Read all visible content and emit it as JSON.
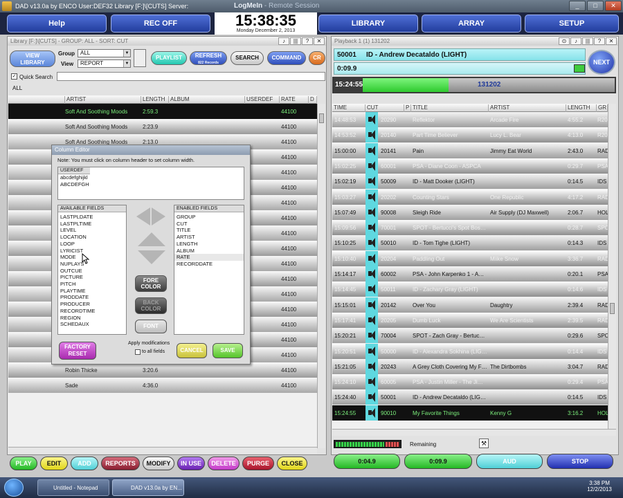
{
  "window": {
    "title": "DAD v13.0a by ENCO User:DEF32 Library [F:]\\[CUTS] Server:",
    "session_title": "LogMeIn",
    "session_sub": " - Remote Session"
  },
  "nav": {
    "help": "Help",
    "rec_off": "REC OFF",
    "library": "LIBRARY",
    "array": "ARRAY",
    "setup": "SETUP"
  },
  "clock": {
    "time": "15:38:35",
    "date": "Monday December 2, 2013"
  },
  "library": {
    "header": "Library [F:]\\[CUTS] - GROUP: ALL  - SORT: CUT",
    "view_library": "VIEW\nLIBRARY",
    "group_label": "Group",
    "group_value": "ALL",
    "view_label": "View",
    "view_value": "REPORT",
    "playlist": "PLAYLIST",
    "refresh": "REFRESH",
    "refresh_sub": "822 Records",
    "search": "SEARCH",
    "command": "COMMAND",
    "cr": "CR",
    "quick_search": "Quick Search",
    "filter_tab": "ALL",
    "columns": [
      "ARTIST",
      "LENGTH",
      "ALBUM",
      "USERDEF",
      "RATE",
      "D"
    ],
    "rows": [
      {
        "artist": "Soft And Soothing Moods",
        "length": "2:59.3",
        "rate": "44100"
      },
      {
        "artist": "Soft And Soothing Moods",
        "length": "2:23.9",
        "rate": "44100"
      },
      {
        "artist": "Soft And Soothing Moods",
        "length": "2:13.0",
        "rate": "44100"
      },
      {
        "artist": "",
        "length": "",
        "rate": "44100"
      },
      {
        "artist": "",
        "length": "",
        "rate": "44100"
      },
      {
        "artist": "",
        "length": "",
        "rate": "44100"
      },
      {
        "artist": "",
        "length": "",
        "rate": "44100"
      },
      {
        "artist": "",
        "length": "",
        "rate": "44100"
      },
      {
        "artist": "",
        "length": "",
        "rate": "44100"
      },
      {
        "artist": "",
        "length": "",
        "rate": "44100"
      },
      {
        "artist": "",
        "length": "",
        "rate": "44100"
      },
      {
        "artist": "",
        "length": "",
        "rate": "44100"
      },
      {
        "artist": "",
        "length": "",
        "rate": "44100"
      },
      {
        "artist": "",
        "length": "",
        "rate": "44100"
      },
      {
        "artist": "Sade",
        "length": "4:02.0",
        "rate": "44100"
      },
      {
        "artist": "Paul Taylor",
        "length": "3:50.8",
        "rate": "44100"
      },
      {
        "artist": "Harry Connick Jr.",
        "length": "3:37.7",
        "rate": "44100"
      },
      {
        "artist": "Robin Thicke",
        "length": "3:20.6",
        "rate": "44100"
      },
      {
        "artist": "Sade",
        "length": "4:36.0",
        "rate": "44100"
      }
    ]
  },
  "column_editor": {
    "title": "Column Editor",
    "note": "Note: You must click on column header to set column width.",
    "userdef_head": "USERDEF",
    "userdef_items": [
      "abcdefghijkl",
      "ABCDEFGH"
    ],
    "available_head": "AVAILABLE FIELDS",
    "available": [
      "LASTPLDATE",
      "LASTPLTIME",
      "LEVEL",
      "LOCATION",
      "LOOP",
      "LYRICIST",
      "MODE",
      "NUPLAYS",
      "OUTCUE",
      "PICTURE",
      "PITCH",
      "PLAYTIME",
      "PRODDATE",
      "PRODUCER",
      "RECORDTIME",
      "REGION",
      "SCHEDAUX"
    ],
    "enabled_head": "ENABLED FIELDS",
    "enabled": [
      "GROUP",
      "CUT",
      "TITLE",
      "ARTIST",
      "LENGTH",
      "ALBUM",
      "RATE",
      "RECORDDATE"
    ],
    "fore_color": "FORE\nCOLOR",
    "back_color": "BACK\nCOLOR",
    "font": "FONT",
    "factory_reset": "FACTORY\nRESET",
    "apply_mod": "Apply modifications",
    "to_all": "to all fields",
    "cancel": "CANCEL",
    "save": "SAVE"
  },
  "playback": {
    "header": "Playback 1 (1) 131202",
    "cut": "50001",
    "title": "ID - Andrew Decataldo (LIGHT)",
    "elapsed": "0:09.9",
    "next": "NEXT",
    "start_time": "15:24:55",
    "progress_cut": "131202",
    "progress": 0.34,
    "columns": [
      "TIME",
      "CUT",
      "P",
      "TITLE",
      "ARTIST",
      "LENGTH",
      "GR"
    ],
    "rows": [
      {
        "time": "14:48:53",
        "cut": "20290",
        "title": "Reflektor",
        "artist": "Arcade Fire",
        "length": "4:55.2",
        "grp": "R20"
      },
      {
        "time": "14:53:52",
        "cut": "20140",
        "title": "Part Time Believer",
        "artist": "Lucy L. Bear",
        "length": "4:13.0",
        "grp": "R20"
      },
      {
        "time": "15:00:00",
        "cut": "20141",
        "title": "Pain",
        "artist": "Jimmy Eat World",
        "length": "2:43.0",
        "grp": "RAD"
      },
      {
        "time": "15:02:25",
        "cut": "60001",
        "title": "PSA - Diane Coon - ASPCA",
        "artist": "",
        "length": "0:29.7",
        "grp": "PSA"
      },
      {
        "time": "15:02:19",
        "cut": "50009",
        "title": "ID - Matt Dooker (LIGHT)",
        "artist": "",
        "length": "0:14.5",
        "grp": "IDS"
      },
      {
        "time": "15:03:27",
        "cut": "20202",
        "title": "Counting Stars",
        "artist": "One Republic",
        "length": "4:17.2",
        "grp": "RAD"
      },
      {
        "time": "15:07:49",
        "cut": "90008",
        "title": "Sleigh Ride",
        "artist": "Air Supply (DJ Maxwell)",
        "length": "2:06.7",
        "grp": "HOL"
      },
      {
        "time": "15:09:56",
        "cut": "70001",
        "title": "SPOT - Bertucci's Spot Boston",
        "artist": "",
        "length": "0:28.7",
        "grp": "SPO"
      },
      {
        "time": "15:10:25",
        "cut": "50010",
        "title": "ID - Tom Tighe (LIGHT)",
        "artist": "",
        "length": "0:14.3",
        "grp": "IDS"
      },
      {
        "time": "15:10:40",
        "cut": "20204",
        "title": "Paddling Out",
        "artist": "Miike Snow",
        "length": "3:36.7",
        "grp": "RAD"
      },
      {
        "time": "15:14:17",
        "cut": "60002",
        "title": "PSA - John Karpenko 1 - Ame...",
        "artist": "",
        "length": "0:20.1",
        "grp": "PSA"
      },
      {
        "time": "15:14:45",
        "cut": "50011",
        "title": "ID - Zachary Gray (LIGHT)",
        "artist": "",
        "length": "0:14.6",
        "grp": "IDS"
      },
      {
        "time": "15:15:01",
        "cut": "20142",
        "title": "Over You",
        "artist": "Daughtry",
        "length": "2:39.4",
        "grp": "RAD"
      },
      {
        "time": "15:17:41",
        "cut": "20205",
        "title": "Dumb Luck",
        "artist": "We Are Scientists",
        "length": "2:39.5",
        "grp": "RAD"
      },
      {
        "time": "15:20:21",
        "cut": "70004",
        "title": "SPOT - Zach Gray - Bertucci'...",
        "artist": "",
        "length": "0:29.6",
        "grp": "SPO"
      },
      {
        "time": "15:20:51",
        "cut": "50000",
        "title": "ID - Alexandra Sokhina (LIGHT)",
        "artist": "",
        "length": "0:14.4",
        "grp": "IDS"
      },
      {
        "time": "15:21:05",
        "cut": "20243",
        "title": "A Grey Cloth Covering My Fac...",
        "artist": "The Dirtbombs",
        "length": "3:04.7",
        "grp": "RAD"
      },
      {
        "time": "15:24:10",
        "cut": "60005",
        "title": "PSA - Justin Miller - The Jimm...",
        "artist": "",
        "length": "0:29.4",
        "grp": "PSA"
      },
      {
        "time": "15:24:40",
        "cut": "50001",
        "title": "ID - Andrew Decataldo (LIGH...",
        "artist": "",
        "length": "0:14.5",
        "grp": "IDS"
      },
      {
        "time": "15:24:55",
        "cut": "90010",
        "title": "My Favorite Things",
        "artist": "Kenny G",
        "length": "3:16.2",
        "grp": "HOL"
      }
    ],
    "remaining": "Remaining",
    "time1": "0:04.9",
    "time2": "0:09.9",
    "aud": "AUD",
    "stop": "STOP"
  },
  "bottom": {
    "play": "PLAY",
    "edit": "EDIT",
    "add": "ADD",
    "reports": "REPORTS",
    "modify": "MODIFY",
    "in_use": "IN USE",
    "delete": "DELETE",
    "purge": "PURGE",
    "close": "CLOSE"
  },
  "taskbar": {
    "notepad": "Untitled - Notepad",
    "dad": "DAD v13.0a by EN...",
    "time": "3:38 PM",
    "date": "12/2/2013"
  },
  "colors": {
    "nav_blue": "#2b47ad",
    "green": "#2ec92e",
    "cyan": "#5fd8e0",
    "magenta": "#c23ac8",
    "red": "#c02a3b",
    "yellow": "#f0e618",
    "purple": "#7a34b8"
  }
}
